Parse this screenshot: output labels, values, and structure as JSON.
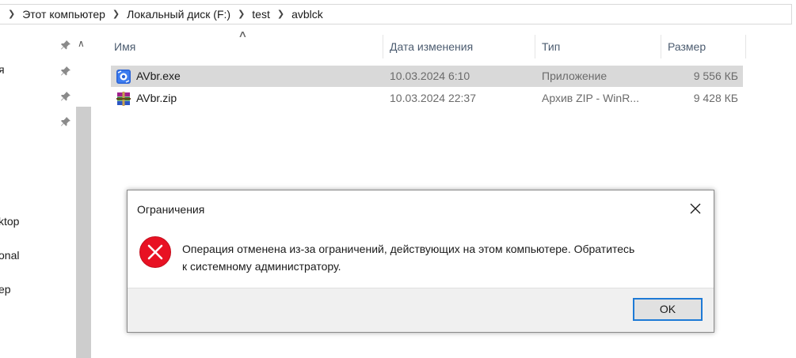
{
  "breadcrumb": {
    "items": [
      "Этот компьютер",
      "Локальный диск (F:)",
      "test",
      "avblck"
    ]
  },
  "nav": {
    "labels": [
      "я",
      "ktop",
      "onal",
      "ер"
    ]
  },
  "file_list": {
    "columns": [
      "Имя",
      "Дата изменения",
      "Тип",
      "Размер"
    ],
    "files": [
      {
        "name": "AVbr.exe",
        "date": "10.03.2024 6:10",
        "type": "Приложение",
        "size": "9 556 КБ",
        "icon": "exe-app-icon",
        "selected": true
      },
      {
        "name": "AVbr.zip",
        "date": "10.03.2024 22:37",
        "type": "Архив ZIP - WinR...",
        "size": "9 428 КБ",
        "icon": "winrar-archive-icon",
        "selected": false
      }
    ]
  },
  "dialog": {
    "title": "Ограничения",
    "message_line1": "Операция отменена из-за ограничений, действующих на этом компьютере. Обратитесь",
    "message_line2": "к системному администратору.",
    "ok_label": "OK",
    "icon": "error-icon"
  },
  "colors": {
    "selection": "#d9d9d9",
    "error_red": "#e81123",
    "button_focus": "#1e7ad6"
  }
}
